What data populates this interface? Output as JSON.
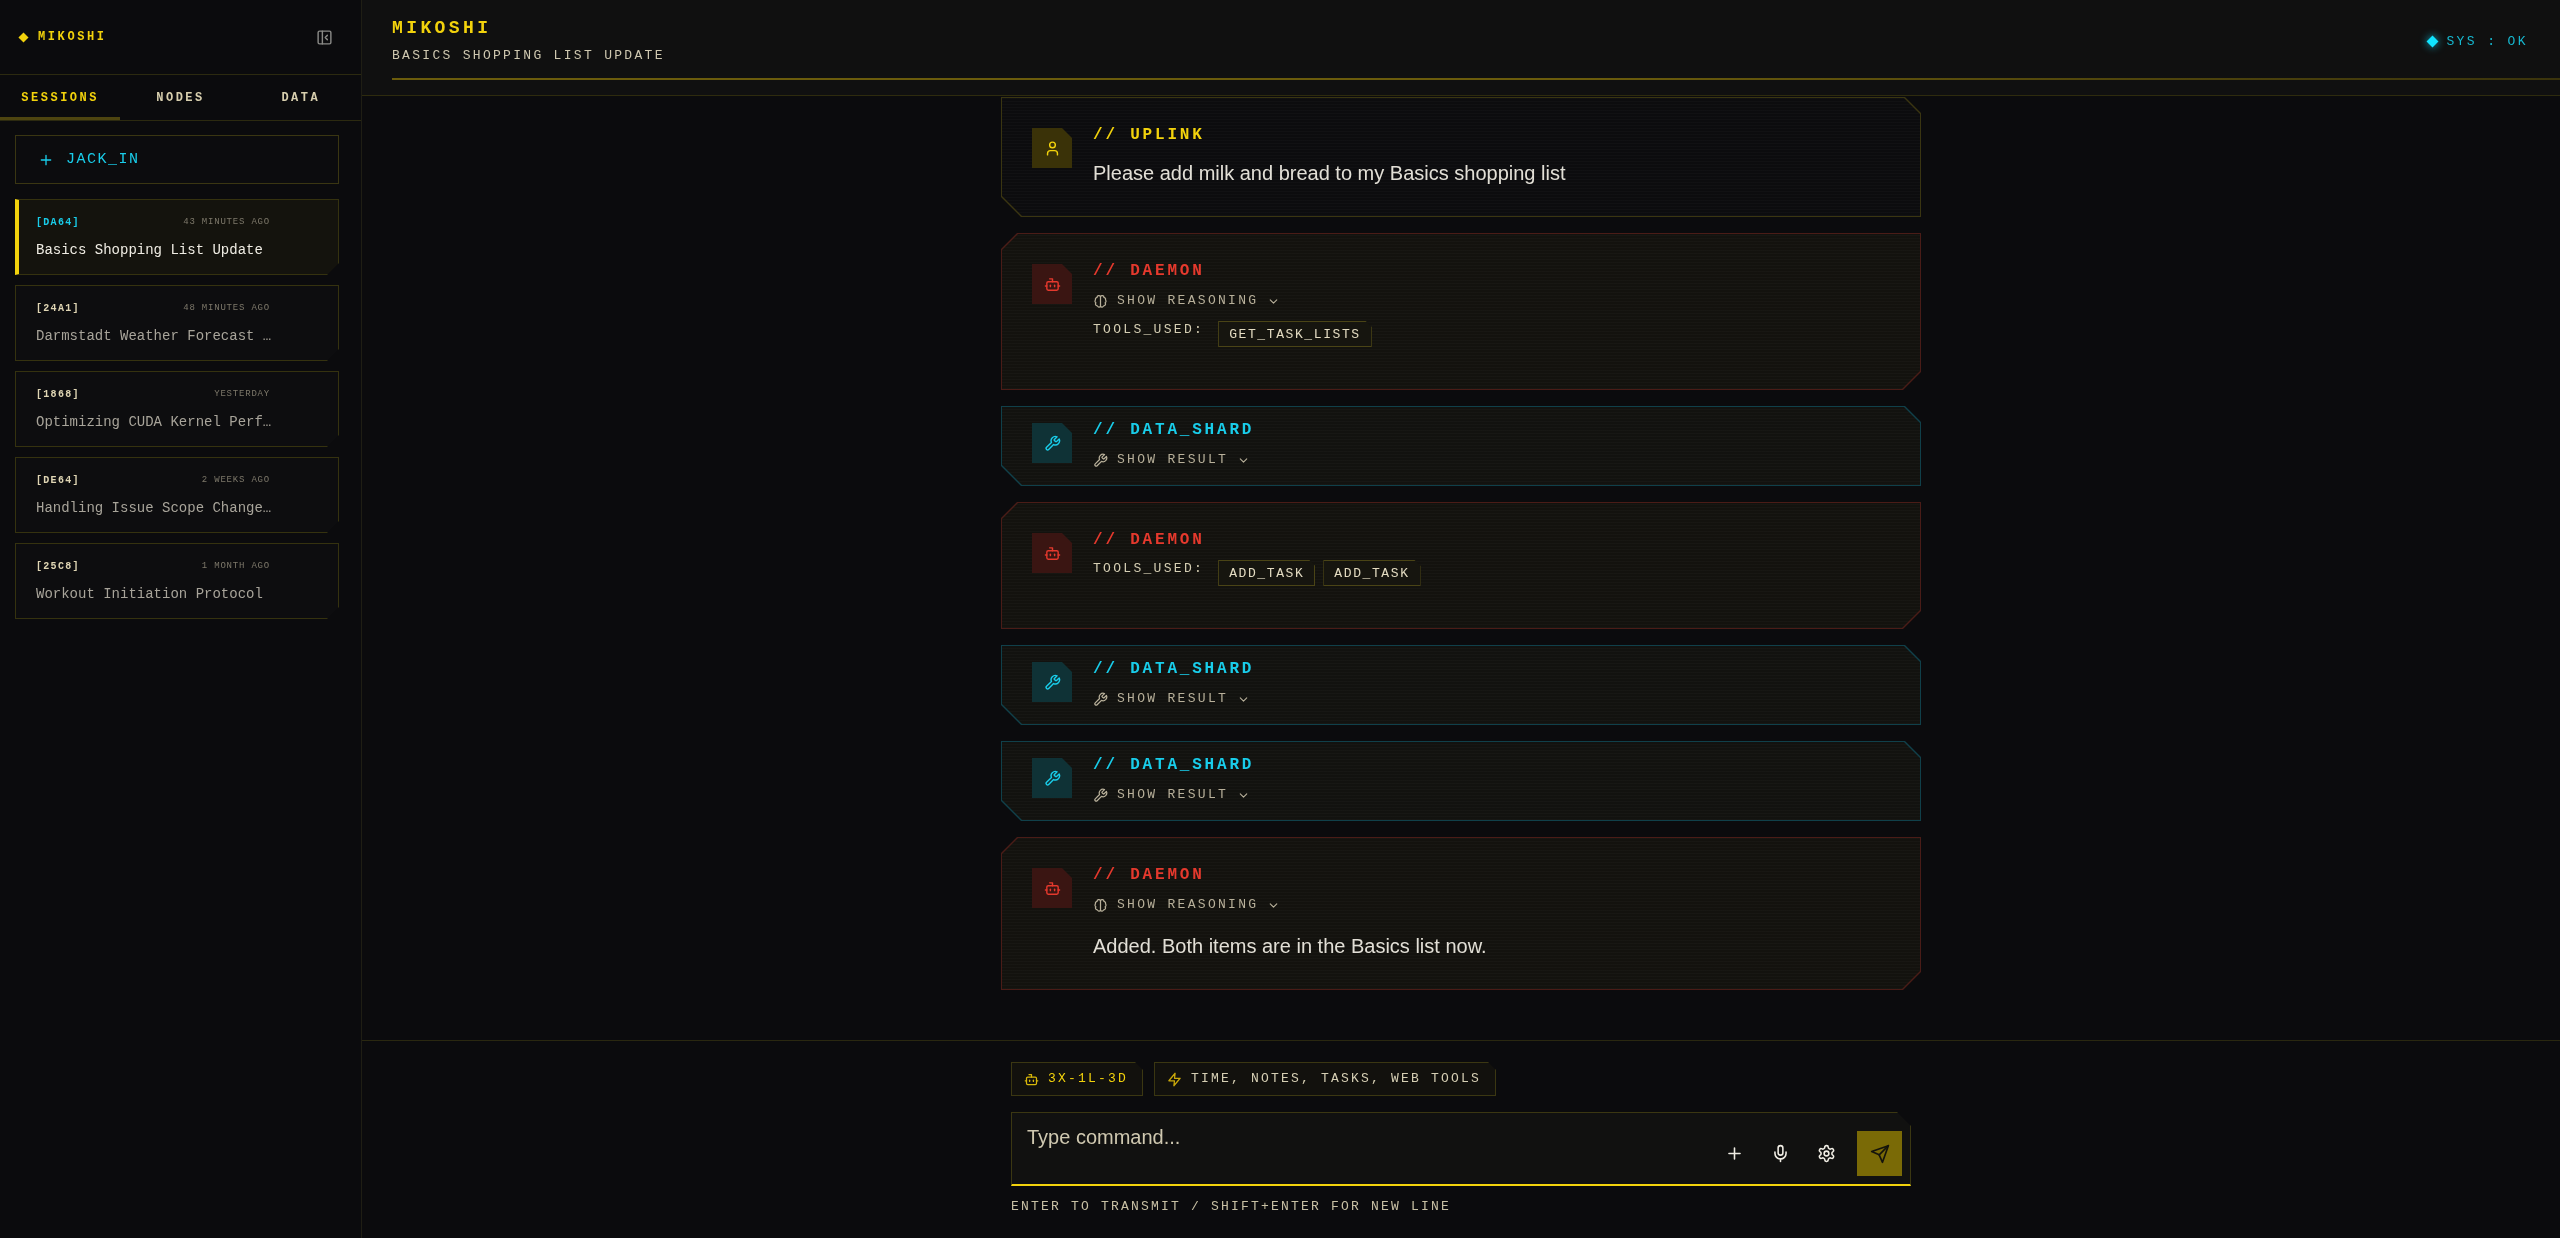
{
  "sidebar": {
    "logo": "MIKOSHI",
    "tabs": [
      {
        "label": "SESSIONS",
        "selected": true
      },
      {
        "label": "NODES",
        "selected": false
      },
      {
        "label": "DATA",
        "selected": false
      }
    ],
    "new_session_button": "JACK_IN",
    "sessions": [
      {
        "id": "[DA64]",
        "time": "43 MINUTES AGO",
        "title": "Basics Shopping List Update",
        "selected": true
      },
      {
        "id": "[24A1]",
        "time": "48 MINUTES AGO",
        "title": "Darmstadt Weather Forecast …",
        "selected": false
      },
      {
        "id": "[1868]",
        "time": "YESTERDAY",
        "title": "Optimizing CUDA Kernel Perf…",
        "selected": false
      },
      {
        "id": "[DE64]",
        "time": "2 WEEKS AGO",
        "title": "Handling Issue Scope Change…",
        "selected": false
      },
      {
        "id": "[25C8]",
        "time": "1 MONTH AGO",
        "title": "Workout Initiation Protocol",
        "selected": false
      }
    ]
  },
  "header": {
    "title": "MIKOSHI",
    "subtitle": "BASICS SHOPPING LIST UPDATE",
    "status": "SYS : OK"
  },
  "messages": [
    {
      "kind": "user",
      "label": "// UPLINK",
      "text": "Please add milk and bread to my Basics shopping list"
    },
    {
      "kind": "assistant",
      "label": "// DAEMON",
      "toggle": {
        "kind": "reasoning",
        "label": "SHOW REASONING",
        "expanded": false
      },
      "tools_label": "TOOLS_USED:",
      "tools": [
        "GET_TASK_LISTS"
      ]
    },
    {
      "kind": "tool",
      "label": "// DATA_SHARD",
      "toggle": {
        "kind": "result",
        "label": "SHOW RESULT",
        "expanded": false
      }
    },
    {
      "kind": "assistant",
      "label": "// DAEMON",
      "tools_label": "TOOLS_USED:",
      "tools": [
        "ADD_TASK",
        "ADD_TASK"
      ]
    },
    {
      "kind": "tool",
      "label": "// DATA_SHARD",
      "toggle": {
        "kind": "result",
        "label": "SHOW RESULT",
        "expanded": false
      }
    },
    {
      "kind": "tool",
      "label": "// DATA_SHARD",
      "toggle": {
        "kind": "result",
        "label": "SHOW RESULT",
        "expanded": false
      }
    },
    {
      "kind": "assistant",
      "label": "// DAEMON",
      "toggle": {
        "kind": "reasoning",
        "label": "SHOW REASONING",
        "expanded": false
      },
      "text": "Added. Both items are in the Basics list now."
    }
  ],
  "composer": {
    "chips": [
      {
        "kind": "model",
        "label": "3X-1L-3D"
      },
      {
        "kind": "tools",
        "label": "TIME, NOTES, TASKS, WEB TOOLS"
      }
    ],
    "placeholder": "Type command...",
    "hint": "ENTER TO TRANSMIT / SHIFT+ENTER FOR NEW LINE"
  }
}
